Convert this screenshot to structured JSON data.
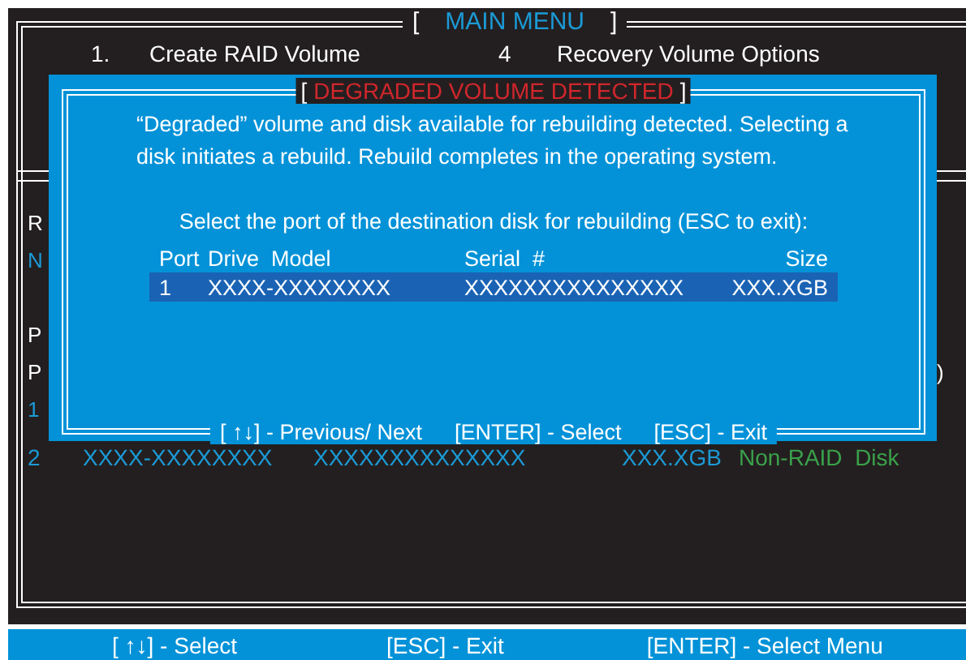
{
  "main_menu": {
    "title": "MAIN MENU",
    "brackets": [
      "[",
      "]"
    ],
    "items": [
      {
        "number": "1.",
        "label": "Create  RAID  Volume"
      },
      {
        "number": "4",
        "label": "Recovery Volume  Options"
      }
    ]
  },
  "background_lines": [
    {
      "text": "R",
      "kind": "plain"
    },
    {
      "text": "N",
      "kind": "accent"
    },
    {
      "text": "P",
      "kind": "plain"
    },
    {
      "text": "P",
      "kind": "plain",
      "trailing": ")"
    },
    {
      "text": "1",
      "kind": "accent"
    }
  ],
  "disk_rows": [
    {
      "port": "2",
      "model": "XXXX-XXXXXXXX",
      "serial": "XXXXXXXXXXXXXX",
      "size": "XXX.XGB",
      "status": "Non-RAID  Disk"
    }
  ],
  "dialog": {
    "title": "DEGRADED VOLUME DETECTED",
    "brackets": [
      "[",
      "]"
    ],
    "message": "“Degraded” volume and disk available for rebuilding detected. Selecting a disk initiates a rebuild. Rebuild completes in the  operating system.",
    "prompt": "Select the port of the destination disk for rebuilding (ESC to exit):",
    "columns": [
      "Port",
      "Drive  Model",
      "Serial  #",
      "Size"
    ],
    "rows": [
      {
        "port": "1",
        "model": "XXXX-XXXXXXXX",
        "serial": "XXXXXXXXXXXXXXX",
        "size": "XXX.XGB",
        "selected": true
      }
    ],
    "help": [
      "[ ↑↓] - Previous/ Next",
      "[ENTER] - Select",
      "[ESC] - Exit"
    ]
  },
  "status_bar": [
    "[ ↑↓] - Select",
    "[ESC] - Exit",
    "[ENTER] - Select Menu"
  ]
}
